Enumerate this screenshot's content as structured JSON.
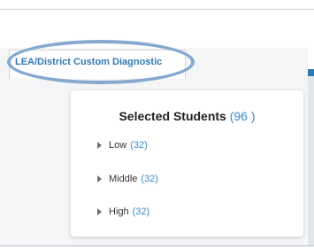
{
  "tab": {
    "label": "LEA/District Custom Diagnostic"
  },
  "panel": {
    "title": "Selected Students",
    "count": "(96 )",
    "groups": [
      {
        "label": "Low",
        "count": "(32)"
      },
      {
        "label": "Middle",
        "count": "(32)"
      },
      {
        "label": "High",
        "count": "(32)"
      }
    ]
  },
  "colors": {
    "accent": "#3079b5",
    "highlight_oval": "#86a8cf",
    "count": "#3a8dc9"
  }
}
